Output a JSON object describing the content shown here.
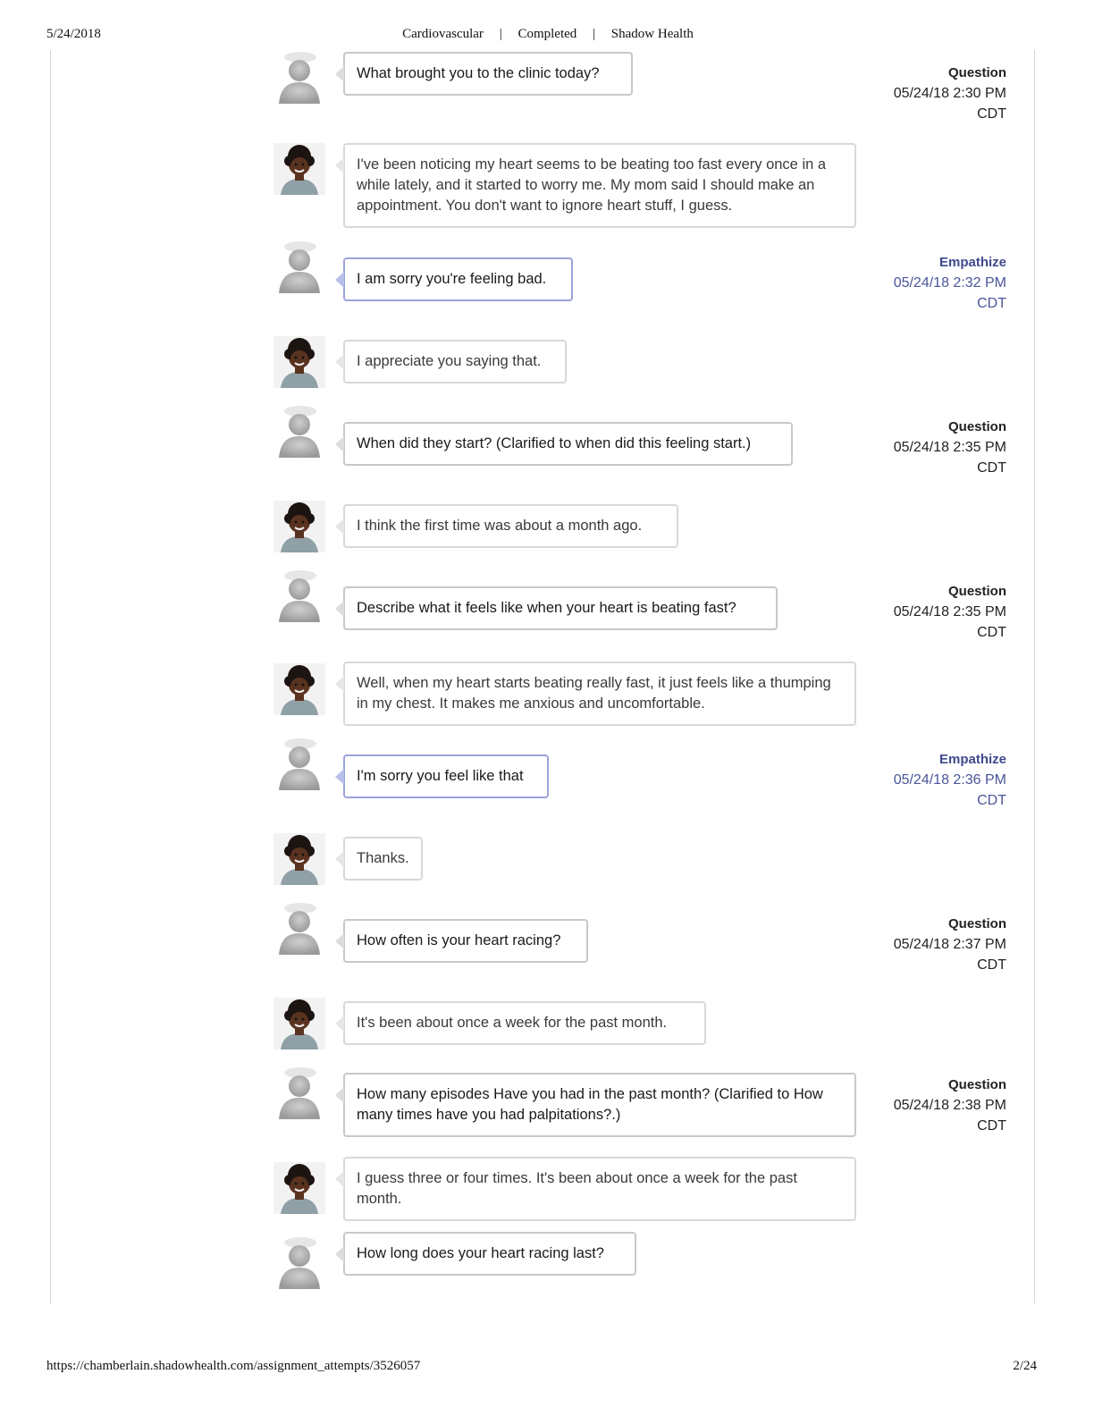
{
  "print_header": {
    "date": "5/24/2018",
    "title_parts": [
      "Cardiovascular",
      "|",
      "Completed",
      "|",
      "Shadow Health"
    ]
  },
  "print_footer": {
    "url": "https://chamberlain.shadowhealth.com/assignment_attempts/3526057",
    "page": "2/24"
  },
  "colors": {
    "empathize_accent": "#4a5599",
    "bubble_border": "#c8c8c8",
    "empathize_border": "#9aa3db"
  },
  "transcript": [
    {
      "speaker": "student",
      "text": "What brought you to the clinic today?",
      "category": "Question",
      "date": "05/24/18 2:30 PM",
      "tz": "CDT"
    },
    {
      "speaker": "patient",
      "text": "I've been noticing my heart seems to be beating too fast every once in a while lately, and it started to worry me. My mom said I should make an appointment. You don't want to ignore heart stuff, I guess."
    },
    {
      "speaker": "student",
      "text": "I am sorry you're feeling bad.",
      "category": "Empathize",
      "date": "05/24/18 2:32 PM",
      "tz": "CDT"
    },
    {
      "speaker": "patient",
      "text": "I appreciate you saying that."
    },
    {
      "speaker": "student",
      "text": "When did they start? (Clarified to when did this feeling start.)",
      "category": "Question",
      "date": "05/24/18 2:35 PM",
      "tz": "CDT"
    },
    {
      "speaker": "patient",
      "text": "I think the first time was about a month ago."
    },
    {
      "speaker": "student",
      "text": "Describe what it feels like when your heart is beating fast?",
      "category": "Question",
      "date": "05/24/18 2:35 PM",
      "tz": "CDT"
    },
    {
      "speaker": "patient",
      "text": "Well, when my heart starts beating really fast, it just feels like a thumping in my chest. It makes me anxious and uncomfortable."
    },
    {
      "speaker": "student",
      "text": "I'm sorry you feel like that",
      "category": "Empathize",
      "date": "05/24/18 2:36 PM",
      "tz": "CDT"
    },
    {
      "speaker": "patient",
      "text": "Thanks."
    },
    {
      "speaker": "student",
      "text": "How often is your heart racing?",
      "category": "Question",
      "date": "05/24/18 2:37 PM",
      "tz": "CDT"
    },
    {
      "speaker": "patient",
      "text": "It's been about once a week for the past month."
    },
    {
      "speaker": "student",
      "text": "How many episodes Have you had in the past month? (Clarified to How many times have you had palpitations?.)",
      "category": "Question",
      "date": "05/24/18 2:38 PM",
      "tz": "CDT"
    },
    {
      "speaker": "patient",
      "text": "I guess three or four times. It's been about once a week for the past month."
    },
    {
      "speaker": "student",
      "text": "How long does your heart racing last?"
    }
  ]
}
